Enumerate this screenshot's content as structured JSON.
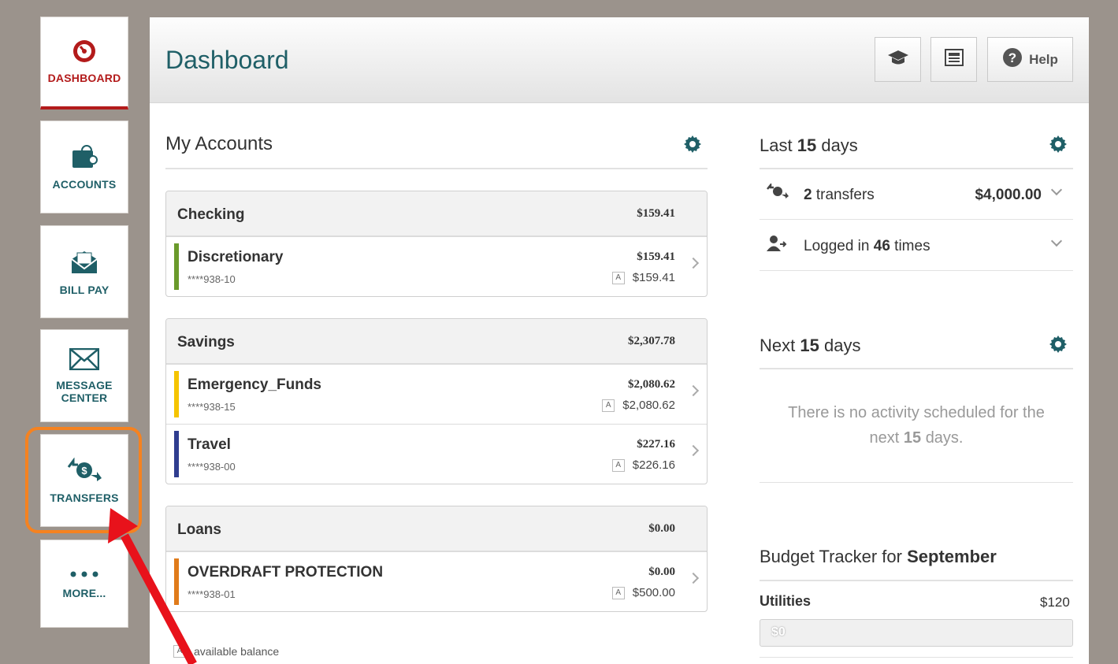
{
  "sidebar": {
    "items": [
      {
        "label": "DASHBOARD",
        "icon": "speedometer-icon",
        "active": true
      },
      {
        "label": "ACCOUNTS",
        "icon": "wallet-icon"
      },
      {
        "label": "BILL PAY",
        "icon": "envelope-bill-icon"
      },
      {
        "label": "MESSAGE CENTER",
        "label_line1": "MESSAGE",
        "label_line2": "CENTER",
        "icon": "mail-icon"
      },
      {
        "label": "TRANSFERS",
        "icon": "transfer-dollar-icon"
      },
      {
        "label": "MORE...",
        "icon": "more-dots-icon"
      }
    ]
  },
  "header": {
    "title": "Dashboard",
    "buttons": {
      "education_icon": "graduation-cap-icon",
      "news_icon": "newspaper-icon",
      "help_label": "Help"
    }
  },
  "accounts": {
    "title": "My Accounts",
    "groups": [
      {
        "name": "Checking",
        "total": "$159.41",
        "rows": [
          {
            "name": "Discretionary",
            "number": "****938-10",
            "balance": "$159.41",
            "available": "$159.41",
            "color": "#6a9a2b"
          }
        ]
      },
      {
        "name": "Savings",
        "total": "$2,307.78",
        "rows": [
          {
            "name": "Emergency_Funds",
            "number": "****938-15",
            "balance": "$2,080.62",
            "available": "$2,080.62",
            "color": "#f5c400"
          },
          {
            "name": "Travel",
            "number": "****938-00",
            "balance": "$227.16",
            "available": "$226.16",
            "color": "#2f3d8f"
          }
        ]
      },
      {
        "name": "Loans",
        "total": "$0.00",
        "rows": [
          {
            "name": "OVERDRAFT PROTECTION",
            "number": "****938-01",
            "balance": "$0.00",
            "available": "$500.00",
            "color": "#e07b1a"
          }
        ]
      }
    ],
    "badge": "A",
    "footnote": "available balance"
  },
  "last15": {
    "title_prefix": "Last",
    "title_num": "15",
    "title_suffix": "days",
    "transfers_count": "2",
    "transfers_label": "transfers",
    "transfers_amount": "$4,000.00",
    "logged_prefix": "Logged in",
    "logged_count": "46",
    "logged_suffix": "times"
  },
  "next15": {
    "title_prefix": "Next",
    "title_num": "15",
    "title_suffix": "days",
    "empty_line1": "There is no activity scheduled for the",
    "empty_prefix": "next",
    "empty_num": "15",
    "empty_suffix": "days."
  },
  "budget": {
    "title_prefix": "Budget Tracker for",
    "month": "September",
    "category": "Utilities",
    "amount": "$120",
    "spent": "$0",
    "spent_fraction": 0
  },
  "colors": {
    "accent": "#1f5f67",
    "active": "#b31b1b",
    "highlight": "#f58220",
    "arrow": "#e8121b"
  }
}
